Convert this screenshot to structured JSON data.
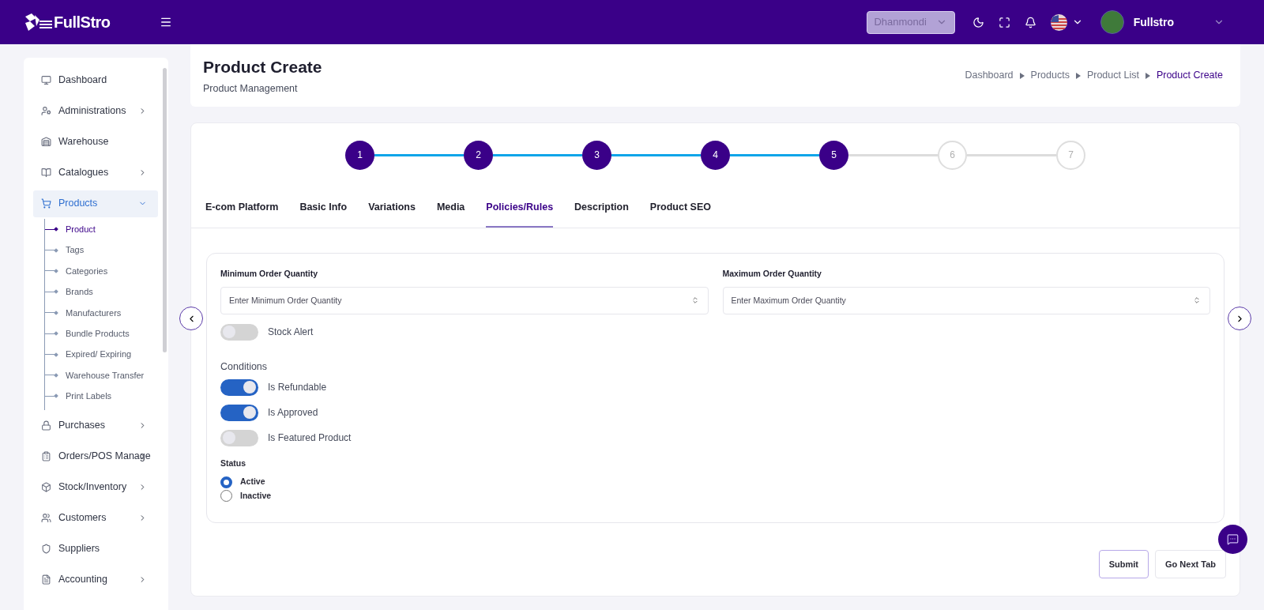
{
  "header": {
    "logo": "FullStro",
    "branch": "Dhanmondi",
    "user": "Fullstro"
  },
  "sidebar": {
    "items": [
      {
        "label": "Dashboard",
        "selected": false
      },
      {
        "label": "Administrations",
        "expanded": false,
        "selected": false
      },
      {
        "label": "Warehouse",
        "selected": false
      },
      {
        "label": "Catalogues",
        "expanded": false,
        "selected": false
      },
      {
        "label": "Products",
        "expanded": true,
        "selected": true,
        "children": [
          {
            "label": "Product",
            "selected": true
          },
          {
            "label": "Tags",
            "selected": false
          },
          {
            "label": "Categories",
            "selected": false
          },
          {
            "label": "Brands",
            "selected": false
          },
          {
            "label": "Manufacturers",
            "selected": false
          },
          {
            "label": "Bundle Products",
            "selected": false
          },
          {
            "label": "Expired/ Expiring",
            "selected": false
          },
          {
            "label": "Warehouse Transfer",
            "selected": false
          },
          {
            "label": "Print Labels",
            "selected": false
          }
        ]
      },
      {
        "label": "Purchases",
        "expanded": false,
        "selected": false
      },
      {
        "label": "Orders/POS Manage",
        "expanded": false,
        "selected": false
      },
      {
        "label": "Stock/Inventory",
        "expanded": false,
        "selected": false
      },
      {
        "label": "Customers",
        "expanded": false,
        "selected": false
      },
      {
        "label": "Suppliers",
        "selected": false
      },
      {
        "label": "Accounting",
        "expanded": false,
        "selected": false
      }
    ]
  },
  "page": {
    "title": "Product Create",
    "subtitle": "Product Management",
    "breadcrumb": [
      {
        "label": "Dashboard",
        "current": false
      },
      {
        "label": "Products",
        "current": false
      },
      {
        "label": "Product List",
        "current": false
      },
      {
        "label": "Product Create",
        "current": true
      }
    ]
  },
  "steps": [
    {
      "label": "1",
      "done": true
    },
    {
      "label": "2",
      "done": true
    },
    {
      "label": "3",
      "done": true
    },
    {
      "label": "4",
      "done": true
    },
    {
      "label": "5",
      "done": true
    },
    {
      "label": "6",
      "done": false
    },
    {
      "label": "7",
      "done": false
    }
  ],
  "tabs": [
    {
      "label": "E-com Platform",
      "selected": false
    },
    {
      "label": "Basic Info",
      "selected": false
    },
    {
      "label": "Variations",
      "selected": false
    },
    {
      "label": "Media",
      "selected": false
    },
    {
      "label": "Policies/Rules",
      "selected": true
    },
    {
      "label": "Description",
      "selected": false
    },
    {
      "label": "Product SEO",
      "selected": false
    }
  ],
  "form": {
    "fields": [
      {
        "label": "Minimum Order Quantity",
        "placeholder": "Enter Minimum Order Quantity"
      },
      {
        "label": "Maximum Order Quantity",
        "placeholder": "Enter Maximum Order Quantity"
      }
    ],
    "stock_alert": {
      "label": "Stock Alert",
      "on": false
    },
    "conditions_title": "Conditions",
    "conditions": [
      {
        "label": "Is Refundable",
        "on": true
      },
      {
        "label": "Is Approved",
        "on": true
      },
      {
        "label": "Is Featured Product",
        "on": false
      }
    ],
    "status_title": "Status",
    "status": [
      {
        "label": "Active",
        "selected": true
      },
      {
        "label": "Inactive",
        "selected": false
      }
    ]
  },
  "buttons": [
    "Submit",
    "Go Next Tab"
  ]
}
